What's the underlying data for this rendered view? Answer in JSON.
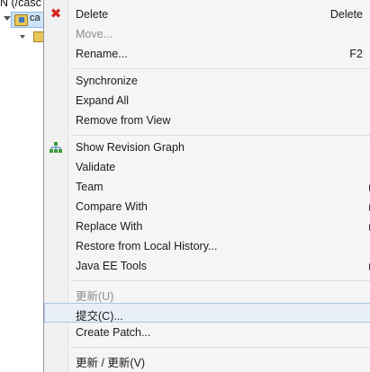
{
  "tree": {
    "top_text": "N (/casc",
    "selected_label": "ca"
  },
  "menu": {
    "items": [
      {
        "label": "Delete",
        "accel": "Delete",
        "icon": "delete-icon",
        "enabled": true
      },
      {
        "label": "Move...",
        "accel": "",
        "enabled": false
      },
      {
        "label": "Rename...",
        "accel": "F2",
        "enabled": true
      },
      {
        "label": "Synchronize",
        "enabled": true
      },
      {
        "label": "Expand All",
        "enabled": true
      },
      {
        "label": "Remove from View",
        "enabled": true
      },
      {
        "label": "Show Revision Graph",
        "icon": "revision-graph-icon",
        "enabled": true
      },
      {
        "label": "Validate",
        "enabled": true
      },
      {
        "label": "Team",
        "submenu": true,
        "enabled": true
      },
      {
        "label": "Compare With",
        "submenu": true,
        "enabled": true
      },
      {
        "label": "Replace With",
        "submenu": true,
        "enabled": true
      },
      {
        "label": "Restore from Local History...",
        "enabled": true
      },
      {
        "label": "Java EE Tools",
        "submenu": true,
        "enabled": true
      },
      {
        "label": "更新(U)",
        "enabled": false
      },
      {
        "label": "提交(C)...",
        "enabled": true,
        "highlighted": true
      },
      {
        "label": "Create Patch...",
        "enabled": true
      },
      {
        "label": "更新 / 更新(V)",
        "enabled": true
      }
    ]
  },
  "colors": {
    "menu_bg": "#f5f5f5",
    "highlight_bg": "#e8eff7",
    "highlight_border": "#a9c6e8",
    "disabled_text": "#8d8d8d",
    "delete_icon": "#d6231f"
  }
}
